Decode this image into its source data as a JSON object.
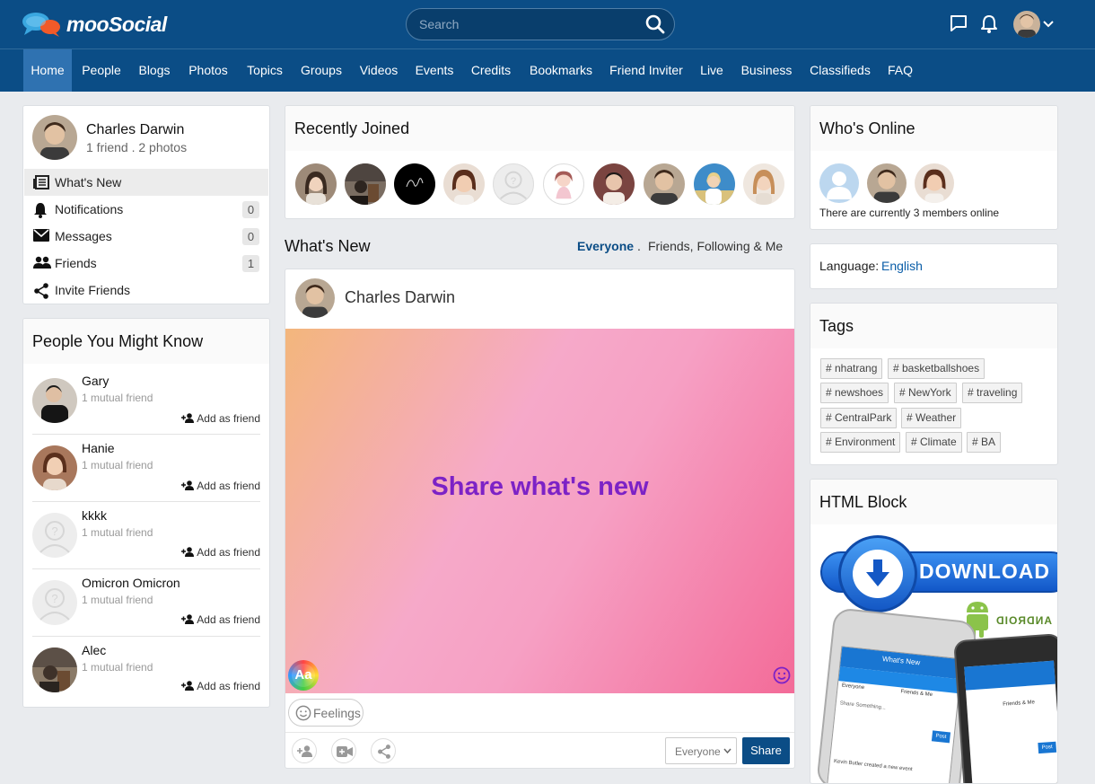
{
  "header": {
    "logo_text": "mooSocial",
    "search_placeholder": "Search",
    "icons": [
      "chat-icon",
      "bell-icon",
      "avatar",
      "chevron-down-icon"
    ]
  },
  "nav": {
    "items": [
      "Home",
      "People",
      "Blogs",
      "Photos",
      "Topics",
      "Groups",
      "Videos",
      "Events",
      "Credits",
      "Bookmarks",
      "Friend Inviter",
      "Live",
      "Business",
      "Classifieds",
      "FAQ"
    ],
    "active": "Home"
  },
  "profile": {
    "name": "Charles Darwin",
    "stats": "1 friend . 2 photos",
    "menu": [
      {
        "label": "What's New",
        "icon": "newspaper-icon",
        "count": null,
        "active": true
      },
      {
        "label": "Notifications",
        "icon": "bell-icon",
        "count": "0"
      },
      {
        "label": "Messages",
        "icon": "envelope-icon",
        "count": "0"
      },
      {
        "label": "Friends",
        "icon": "people-icon",
        "count": "1"
      },
      {
        "label": "Invite Friends",
        "icon": "share-icon",
        "count": null
      }
    ]
  },
  "pymk": {
    "title": "People You Might Know",
    "add_label": "Add as friend",
    "people": [
      {
        "name": "Gary",
        "mutual": "1 mutual friend"
      },
      {
        "name": "Hanie",
        "mutual": "1 mutual friend"
      },
      {
        "name": "kkkk",
        "mutual": "1 mutual friend"
      },
      {
        "name": "Omicron Omicron",
        "mutual": "1 mutual friend"
      },
      {
        "name": "Alec",
        "mutual": "1 mutual friend"
      }
    ]
  },
  "recently_joined": {
    "title": "Recently Joined"
  },
  "whats_new": {
    "title": "What's New",
    "filter_active": "Everyone",
    "filter_sep": ".",
    "filter_other": "Friends, Following & Me",
    "composer_name": "Charles Darwin",
    "prompt": "Share what's new",
    "font_button": "Aa",
    "feelings": "Feelings",
    "privacy": "Everyone",
    "share": "Share"
  },
  "whos_online": {
    "title": "Who's Online",
    "status": "There are currently 3 members online"
  },
  "language": {
    "label": "Language:",
    "value": "English"
  },
  "tags": {
    "title": "Tags",
    "items": [
      "# nhatrang",
      "# basketballshoes",
      "# newshoes",
      "# NewYork",
      "# traveling",
      "# CentralPark",
      "# Weather",
      "# Environment",
      "# Climate",
      "# BA"
    ]
  },
  "html_block": {
    "title": "HTML Block",
    "download_label": "DOWNLOAD",
    "android_label": "ANDROID",
    "phone_left_title": "What's New",
    "phone_left_tab1": "Everyone",
    "phone_left_tab2": "Friends & Me",
    "phone_left_prompt": "Share Something...",
    "phone_left_post": "Post",
    "phone_left_feed": "Kevin Butler created a new event",
    "phone_right_tab": "Friends & Me",
    "phone_right_post": "Post"
  },
  "colors": {
    "brand": "#0b4d86",
    "active_nav": "#2f72b1",
    "prompt": "#7c22c6"
  }
}
